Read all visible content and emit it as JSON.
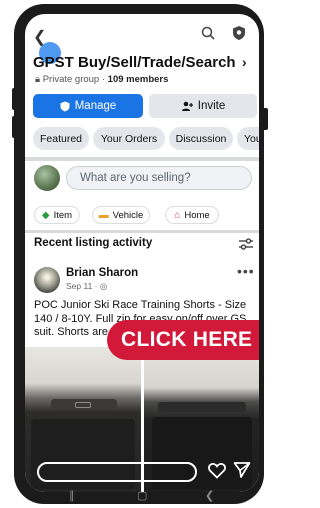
{
  "group": {
    "title": "GPST Buy/Sell/Trade/Search",
    "privacy": "Private group",
    "members": "109 members"
  },
  "actions": {
    "manage_label": "Manage",
    "invite_label": "Invite"
  },
  "tabs": [
    {
      "label": "Featured"
    },
    {
      "label": "Your Orders"
    },
    {
      "label": "Discussion"
    },
    {
      "label": "Your"
    }
  ],
  "composer": {
    "placeholder": "What are you selling?"
  },
  "categories": [
    {
      "label": "Item",
      "icon": "tag-icon",
      "color": "#2a9d3c"
    },
    {
      "label": "Vehicle",
      "icon": "car-icon",
      "color": "#e7a32b"
    },
    {
      "label": "Home",
      "icon": "home-icon",
      "color": "#e4344f"
    }
  ],
  "recent": {
    "title": "Recent listing activity"
  },
  "post": {
    "author": "Brian Sharon",
    "date": "Sep 11",
    "text": "POC Junior Ski Race Training Shorts - Size 140 / 8-10Y.  Full zip for easy on/off over GS suit.  Shorts are"
  },
  "overlay": {
    "cta_label": "CLICK HERE",
    "cta_color": "#d3193a",
    "accent_color": "#1b74e4"
  }
}
